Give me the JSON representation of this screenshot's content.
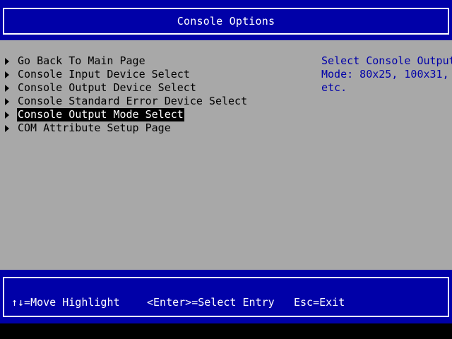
{
  "header": {
    "title": "Console Options"
  },
  "menu": {
    "items": [
      {
        "label": "Go Back To Main Page",
        "selected": false
      },
      {
        "label": "Console Input Device Select",
        "selected": false
      },
      {
        "label": "Console Output Device Select",
        "selected": false
      },
      {
        "label": "Console Standard Error Device Select",
        "selected": false
      },
      {
        "label": "Console Output Mode Select",
        "selected": true
      },
      {
        "label": "COM Attribute Setup Page",
        "selected": false
      }
    ]
  },
  "help": {
    "lines": [
      "Select Console Output",
      "Mode: 80x25, 100x31,",
      "etc."
    ]
  },
  "footer": {
    "move": "↑↓=Move Highlight",
    "enter": "<Enter>=Select Entry",
    "esc": "Esc=Exit"
  },
  "colors": {
    "bios_blue": "#0000a8",
    "panel_gray": "#a8a8a8",
    "highlight_bg": "#000000",
    "highlight_fg": "#ffffff",
    "help_text": "#0000a8"
  }
}
